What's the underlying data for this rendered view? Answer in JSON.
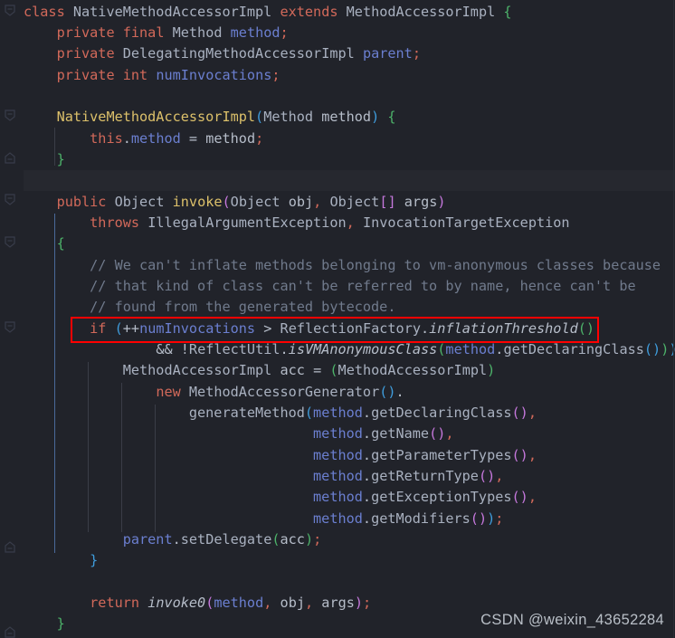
{
  "editor": {
    "background_color": "#21232a",
    "caret_line_color": "#26282f",
    "language": "java",
    "theme": "dark"
  },
  "annotation": {
    "type": "red-rectangle",
    "color": "#ff0000",
    "target_text": "(++numInvocations > ReflectionFactory.inflationThreshold()"
  },
  "watermark": {
    "text": "CSDN @weixin_43652284"
  },
  "colors": {
    "keyword": "#d2695a",
    "type": "#a9b1c0",
    "field": "#6b7fd0",
    "method": "#dcc06a",
    "comment": "#707a8c",
    "brace_green": "#4db36a",
    "brace_blue": "#3f9ddd",
    "punctuation": "#d2695a",
    "annotation": "#ff0000"
  },
  "code": {
    "lines": [
      {
        "n": 1,
        "text": "class NativeMethodAccessorImpl extends MethodAccessorImpl {"
      },
      {
        "n": 2,
        "text": "    private final Method method;"
      },
      {
        "n": 3,
        "text": "    private DelegatingMethodAccessorImpl parent;"
      },
      {
        "n": 4,
        "text": "    private int numInvocations;"
      },
      {
        "n": 5,
        "text": ""
      },
      {
        "n": 6,
        "text": "    NativeMethodAccessorImpl(Method method) {"
      },
      {
        "n": 7,
        "text": "        this.method = method;"
      },
      {
        "n": 8,
        "text": "    }"
      },
      {
        "n": 9,
        "text": ""
      },
      {
        "n": 10,
        "text": "    public Object invoke(Object obj, Object[] args)"
      },
      {
        "n": 11,
        "text": "        throws IllegalArgumentException, InvocationTargetException"
      },
      {
        "n": 12,
        "text": "    {"
      },
      {
        "n": 13,
        "text": "        // We can't inflate methods belonging to vm-anonymous classes because"
      },
      {
        "n": 14,
        "text": "        // that kind of class can't be referred to by name, hence can't be"
      },
      {
        "n": 15,
        "text": "        // found from the generated bytecode."
      },
      {
        "n": 16,
        "text": "        if (++numInvocations > ReflectionFactory.inflationThreshold()"
      },
      {
        "n": 17,
        "text": "                && !ReflectUtil.isVMAnonymousClass(method.getDeclaringClass())) {"
      },
      {
        "n": 18,
        "text": "            MethodAccessorImpl acc = (MethodAccessorImpl)"
      },
      {
        "n": 19,
        "text": "                new MethodAccessorGenerator()."
      },
      {
        "n": 20,
        "text": "                    generateMethod(method.getDeclaringClass(),"
      },
      {
        "n": 21,
        "text": "                                   method.getName(),"
      },
      {
        "n": 22,
        "text": "                                   method.getParameterTypes(),"
      },
      {
        "n": 23,
        "text": "                                   method.getReturnType(),"
      },
      {
        "n": 24,
        "text": "                                   method.getExceptionTypes(),"
      },
      {
        "n": 25,
        "text": "                                   method.getModifiers());"
      },
      {
        "n": 26,
        "text": "            parent.setDelegate(acc);"
      },
      {
        "n": 27,
        "text": "        }"
      },
      {
        "n": 28,
        "text": ""
      },
      {
        "n": 29,
        "text": "        return invoke0(method, obj, args);"
      },
      {
        "n": 30,
        "text": "    }"
      }
    ]
  },
  "gutter": {
    "fold_markers": [
      {
        "line": 1,
        "state": "expanded"
      },
      {
        "line": 6,
        "state": "expanded"
      },
      {
        "line": 8,
        "state": "collapsed-end"
      },
      {
        "line": 10,
        "state": "expanded"
      },
      {
        "line": 12,
        "state": "expanded"
      },
      {
        "line": 16,
        "state": "expanded"
      },
      {
        "line": 26,
        "state": "collapsed-end"
      },
      {
        "line": 30,
        "state": "collapsed-end"
      }
    ]
  }
}
